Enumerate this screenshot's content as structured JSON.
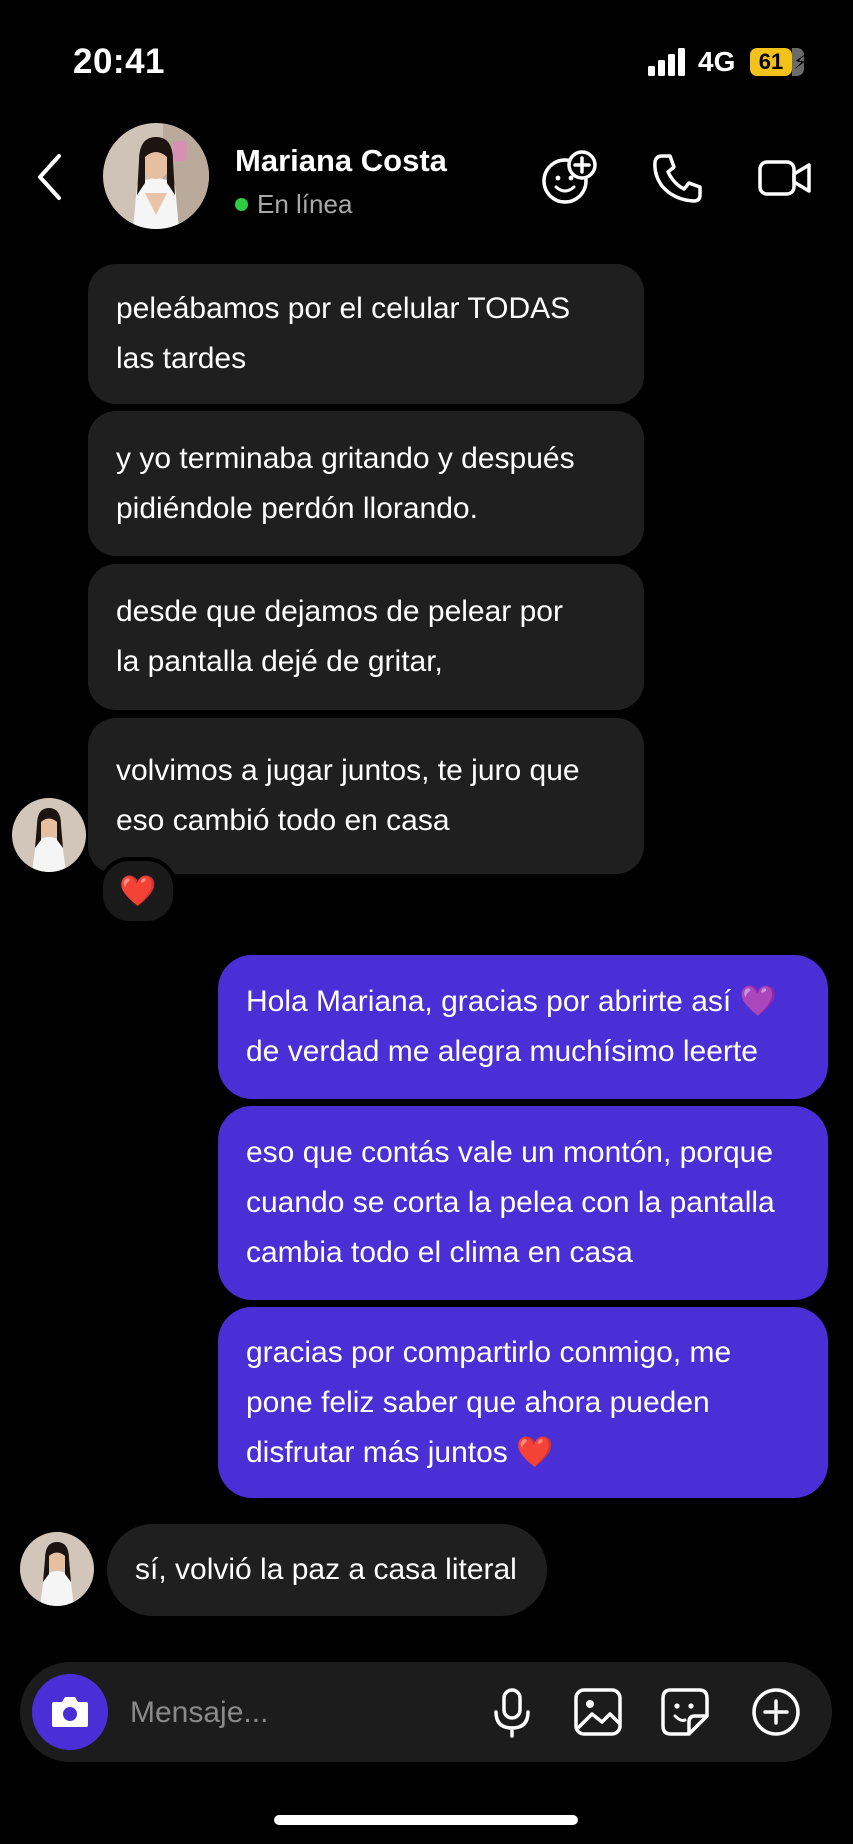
{
  "status_bar": {
    "time": "20:41",
    "network": "4G",
    "battery": "61"
  },
  "header": {
    "name": "Mariana Costa",
    "status": "En línea",
    "icons": [
      "back-chevron-icon",
      "add-emoji-icon",
      "phone-icon",
      "video-camera-icon"
    ]
  },
  "messages": [
    {
      "side": "incoming",
      "text": "peleábamos por el celular TODAS\nlas tardes"
    },
    {
      "side": "incoming",
      "text": "y yo terminaba gritando y después\npidiéndole perdón llorando."
    },
    {
      "side": "incoming",
      "text": "desde que dejamos de pelear por\nla pantalla dejé de gritar,"
    },
    {
      "side": "incoming",
      "text": "volvimos a jugar juntos, te juro que\neso cambió todo en casa",
      "reaction": "❤️"
    },
    {
      "side": "outgoing",
      "text": "Hola Mariana, gracias por abrirte así 💜\nde verdad me alegra muchísimo leerte"
    },
    {
      "side": "outgoing",
      "text": "eso que contás vale un montón, porque\ncuando se corta la pelea con la pantalla\ncambia todo el clima en casa"
    },
    {
      "side": "outgoing",
      "text": "gracias por compartirlo conmigo, me\npone feliz saber que ahora pueden\ndisfrutar más juntos ❤️"
    },
    {
      "side": "incoming",
      "text": "sí, volvió la paz a casa literal"
    }
  ],
  "composer": {
    "placeholder": "Mensaje...",
    "icons": [
      "camera-icon",
      "microphone-icon",
      "image-icon",
      "sticker-icon",
      "plus-circle-icon"
    ]
  },
  "colors": {
    "background": "#000000",
    "incoming_bubble": "#1f1f1f",
    "outgoing_bubble": "#4a2fd7",
    "online": "#2ecc40",
    "battery": "#f2c21b"
  }
}
